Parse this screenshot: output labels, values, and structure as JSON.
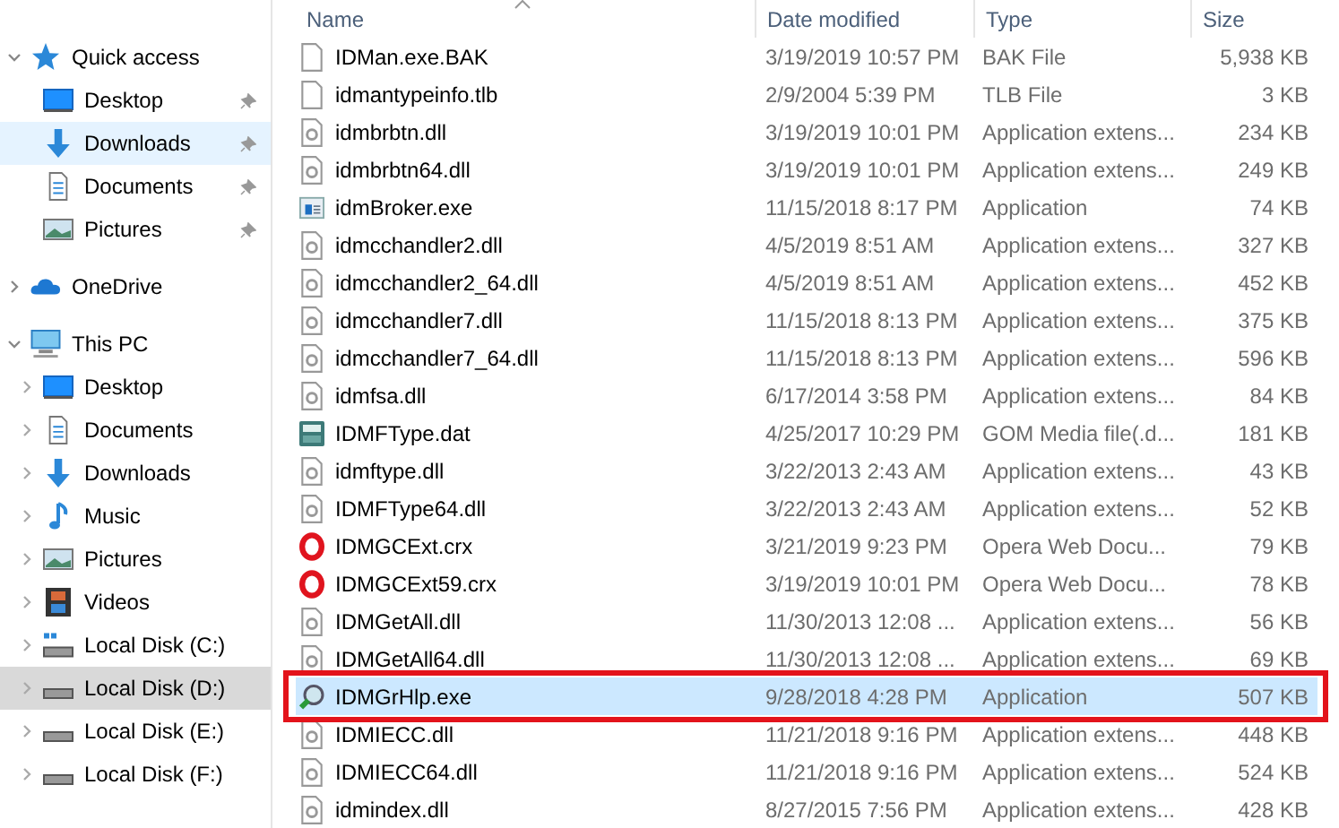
{
  "sidebar": {
    "sections": [
      {
        "label": "Quick access",
        "kind": "star",
        "expanded": true,
        "children": [
          {
            "label": "Desktop",
            "kind": "desktop",
            "pinned": true,
            "hovered": false,
            "selected": false
          },
          {
            "label": "Downloads",
            "kind": "downloads",
            "pinned": true,
            "hovered": true,
            "selected": false
          },
          {
            "label": "Documents",
            "kind": "documents",
            "pinned": true,
            "hovered": false,
            "selected": false
          },
          {
            "label": "Pictures",
            "kind": "pictures",
            "pinned": true,
            "hovered": false,
            "selected": false
          }
        ]
      },
      {
        "label": "OneDrive",
        "kind": "cloud",
        "expanded": false
      },
      {
        "label": "This PC",
        "kind": "pc",
        "expanded": true,
        "children": [
          {
            "label": "Desktop",
            "kind": "desktop",
            "pinned": false,
            "hovered": false,
            "selected": false
          },
          {
            "label": "Documents",
            "kind": "documents",
            "pinned": false,
            "hovered": false,
            "selected": false
          },
          {
            "label": "Downloads",
            "kind": "downloads",
            "pinned": false,
            "hovered": false,
            "selected": false
          },
          {
            "label": "Music",
            "kind": "music",
            "pinned": false,
            "hovered": false,
            "selected": false
          },
          {
            "label": "Pictures",
            "kind": "pictures",
            "pinned": false,
            "hovered": false,
            "selected": false
          },
          {
            "label": "Videos",
            "kind": "videos",
            "pinned": false,
            "hovered": false,
            "selected": false
          },
          {
            "label": "Local Disk (C:)",
            "kind": "sysdrive",
            "pinned": false,
            "hovered": false,
            "selected": false
          },
          {
            "label": "Local Disk (D:)",
            "kind": "drive",
            "pinned": false,
            "hovered": false,
            "selected": true
          },
          {
            "label": "Local Disk (E:)",
            "kind": "drive",
            "pinned": false,
            "hovered": false,
            "selected": false
          },
          {
            "label": "Local Disk (F:)",
            "kind": "drive",
            "pinned": false,
            "hovered": false,
            "selected": false
          }
        ]
      }
    ]
  },
  "table": {
    "columns": [
      {
        "label": "Name",
        "sorted": true
      },
      {
        "label": "Date modified",
        "sorted": false
      },
      {
        "label": "Type",
        "sorted": false
      },
      {
        "label": "Size",
        "sorted": false
      }
    ],
    "rows": [
      {
        "kind": "blank",
        "name": "IDMan.exe.BAK",
        "date": "3/19/2019 10:57 PM",
        "type": "BAK File",
        "size": "5,938 KB",
        "selected": false,
        "framed": false
      },
      {
        "kind": "blank",
        "name": "idmantypeinfo.tlb",
        "date": "2/9/2004 5:39 PM",
        "type": "TLB File",
        "size": "3 KB",
        "selected": false,
        "framed": false
      },
      {
        "kind": "dll",
        "name": "idmbrbtn.dll",
        "date": "3/19/2019 10:01 PM",
        "type": "Application extens...",
        "size": "234 KB",
        "selected": false,
        "framed": false
      },
      {
        "kind": "dll",
        "name": "idmbrbtn64.dll",
        "date": "3/19/2019 10:01 PM",
        "type": "Application extens...",
        "size": "249 KB",
        "selected": false,
        "framed": false
      },
      {
        "kind": "window",
        "name": "idmBroker.exe",
        "date": "11/15/2018 8:17 PM",
        "type": "Application",
        "size": "74 KB",
        "selected": false,
        "framed": false
      },
      {
        "kind": "dll",
        "name": "idmcchandler2.dll",
        "date": "4/5/2019 8:51 AM",
        "type": "Application extens...",
        "size": "327 KB",
        "selected": false,
        "framed": false
      },
      {
        "kind": "dll",
        "name": "idmcchandler2_64.dll",
        "date": "4/5/2019 8:51 AM",
        "type": "Application extens...",
        "size": "452 KB",
        "selected": false,
        "framed": false
      },
      {
        "kind": "dll",
        "name": "idmcchandler7.dll",
        "date": "11/15/2018 8:13 PM",
        "type": "Application extens...",
        "size": "375 KB",
        "selected": false,
        "framed": false
      },
      {
        "kind": "dll",
        "name": "idmcchandler7_64.dll",
        "date": "11/15/2018 8:13 PM",
        "type": "Application extens...",
        "size": "596 KB",
        "selected": false,
        "framed": false
      },
      {
        "kind": "dll",
        "name": "idmfsa.dll",
        "date": "6/17/2014 3:58 PM",
        "type": "Application extens...",
        "size": "84 KB",
        "selected": false,
        "framed": false
      },
      {
        "kind": "dat",
        "name": "IDMFType.dat",
        "date": "4/25/2017 10:29 PM",
        "type": "GOM Media file(.d...",
        "size": "181 KB",
        "selected": false,
        "framed": false
      },
      {
        "kind": "dll",
        "name": "idmftype.dll",
        "date": "3/22/2013 2:43 AM",
        "type": "Application extens...",
        "size": "43 KB",
        "selected": false,
        "framed": false
      },
      {
        "kind": "dll",
        "name": "IDMFType64.dll",
        "date": "3/22/2013 2:43 AM",
        "type": "Application extens...",
        "size": "52 KB",
        "selected": false,
        "framed": false
      },
      {
        "kind": "opera",
        "name": "IDMGCExt.crx",
        "date": "3/21/2019 9:23 PM",
        "type": "Opera Web Docu...",
        "size": "79 KB",
        "selected": false,
        "framed": false
      },
      {
        "kind": "opera",
        "name": "IDMGCExt59.crx",
        "date": "3/19/2019 10:01 PM",
        "type": "Opera Web Docu...",
        "size": "78 KB",
        "selected": false,
        "framed": false
      },
      {
        "kind": "dll",
        "name": "IDMGetAll.dll",
        "date": "11/30/2013 12:08 ...",
        "type": "Application extens...",
        "size": "56 KB",
        "selected": false,
        "framed": false
      },
      {
        "kind": "dll",
        "name": "IDMGetAll64.dll",
        "date": "11/30/2013 12:08 ...",
        "type": "Application extens...",
        "size": "69 KB",
        "selected": false,
        "framed": false
      },
      {
        "kind": "grabber",
        "name": "IDMGrHlp.exe",
        "date": "9/28/2018 4:28 PM",
        "type": "Application",
        "size": "507 KB",
        "selected": true,
        "framed": true
      },
      {
        "kind": "dll",
        "name": "IDMIECC.dll",
        "date": "11/21/2018 9:16 PM",
        "type": "Application extens...",
        "size": "448 KB",
        "selected": false,
        "framed": false
      },
      {
        "kind": "dll",
        "name": "IDMIECC64.dll",
        "date": "11/21/2018 9:16 PM",
        "type": "Application extens...",
        "size": "524 KB",
        "selected": false,
        "framed": false
      },
      {
        "kind": "dll",
        "name": "idmindex.dll",
        "date": "8/27/2015 7:56 PM",
        "type": "Application extens...",
        "size": "428 KB",
        "selected": false,
        "framed": false
      }
    ]
  }
}
